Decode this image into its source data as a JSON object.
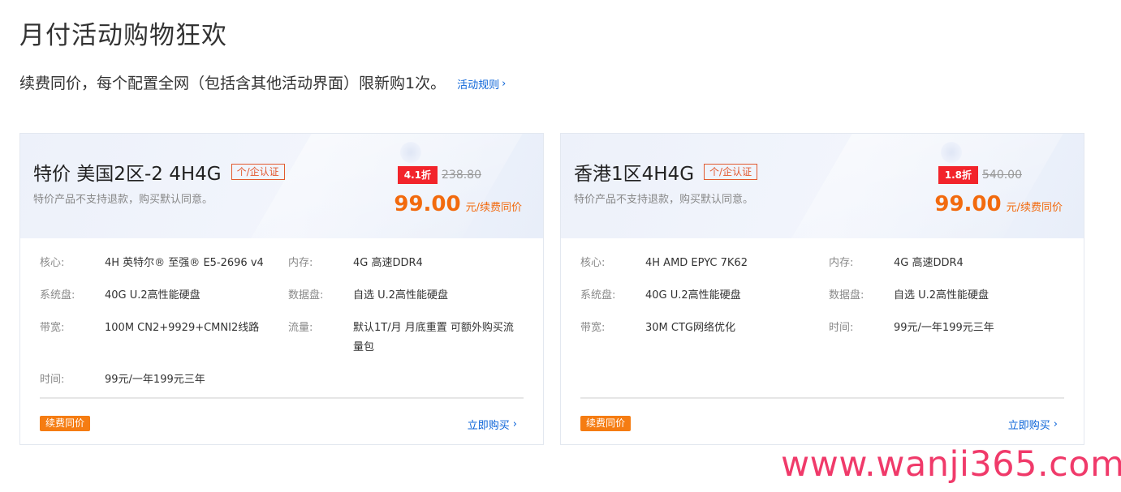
{
  "page": {
    "title": "月付活动购物狂欢",
    "subtitle": "续费同价，每个配置全网（包括含其他活动界面）限新购1次。",
    "rules_link": "活动规则"
  },
  "cards": [
    {
      "title": "特价 美国2区-2 4H4G",
      "cert": "个/企认证",
      "note": "特价产品不支持退款，购买默认同意。",
      "discount": "4.1折",
      "original_price": "238.80",
      "price": "99.00",
      "price_unit": "元/续费同价",
      "specs": {
        "cpu_label": "核心:",
        "cpu": "4H 英特尔® 至强® E5-2696 v4",
        "mem_label": "内存:",
        "mem": "4G 高速DDR4",
        "sys_label": "系统盘:",
        "sys": "40G U.2高性能硬盘",
        "data_label": "数据盘:",
        "data": "自选 U.2高性能硬盘",
        "bw_label": "带宽:",
        "bw": "100M CN2+9929+CMNI2线路",
        "traffic_label": "流量:",
        "traffic_line1": "默认1T/月 月底重置 可额外购买流",
        "traffic_line2": "量包",
        "time_label": "时间:",
        "time": "99元/一年199元三年"
      },
      "renew_tag": "续费同价",
      "buy": "立即购买"
    },
    {
      "title": "香港1区4H4G",
      "cert": "个/企认证",
      "note": "特价产品不支持退款，购买默认同意。",
      "discount": "1.8折",
      "original_price": "540.00",
      "price": "99.00",
      "price_unit": "元/续费同价",
      "specs": {
        "cpu_label": "核心:",
        "cpu": "4H AMD EPYC 7K62",
        "mem_label": "内存:",
        "mem": "4G 高速DDR4",
        "sys_label": "系统盘:",
        "sys": "40G U.2高性能硬盘",
        "data_label": "数据盘:",
        "data": "自选 U.2高性能硬盘",
        "bw_label": "带宽:",
        "bw": "30M CTG网络优化",
        "time_label": "时间:",
        "time": "99元/一年199元三年"
      },
      "renew_tag": "续费同价",
      "buy": "立即购买"
    }
  ],
  "watermark": "www.wanji365.com",
  "colors": {
    "accent_orange": "#f26a0e",
    "link_blue": "#0a63d8",
    "discount_red": "#f2242b",
    "watermark": "#f03a6a"
  }
}
